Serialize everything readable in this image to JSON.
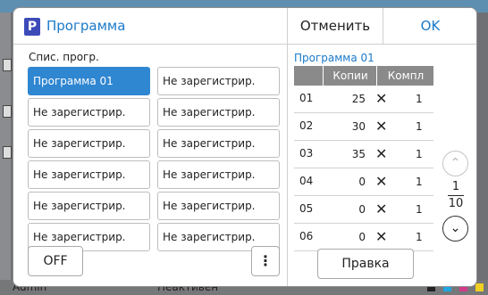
{
  "background": {
    "status": {
      "user": "Admin",
      "state": "Неактивен"
    }
  },
  "dialog": {
    "title": "Программа",
    "icon_letter": "P",
    "cancel_label": "Отменить",
    "ok_label": "OK"
  },
  "program_list": {
    "label": "Спис. прогр.",
    "items": [
      {
        "label": "Программа 01",
        "selected": true
      },
      {
        "label": "Не зарегистрир."
      },
      {
        "label": "Не зарегистрир."
      },
      {
        "label": "Не зарегистрир."
      },
      {
        "label": "Не зарегистрир."
      },
      {
        "label": "Не зарегистрир."
      },
      {
        "label": "Не зарегистрир."
      },
      {
        "label": "Не зарегистрир."
      },
      {
        "label": "Не зарегистрир."
      },
      {
        "label": "Не зарегистрир."
      },
      {
        "label": "Не зарегистрир."
      },
      {
        "label": "Не зарегистрир."
      }
    ],
    "off_label": "OFF",
    "more_label": "⋮"
  },
  "program_detail": {
    "title": "Программа 01",
    "headers": {
      "copies": "Копии",
      "sets": "Компл"
    },
    "times_symbol": "✕",
    "rows": [
      {
        "num": "01",
        "copies": "25",
        "sets": "1"
      },
      {
        "num": "02",
        "copies": "30",
        "sets": "1"
      },
      {
        "num": "03",
        "copies": "35",
        "sets": "1"
      },
      {
        "num": "04",
        "copies": "0",
        "sets": "1"
      },
      {
        "num": "05",
        "copies": "0",
        "sets": "1"
      },
      {
        "num": "06",
        "copies": "0",
        "sets": "1"
      }
    ],
    "page": {
      "current": "1",
      "total": "10"
    },
    "edit_label": "Правка"
  },
  "colors": {
    "accent": "#1979c9",
    "selected": "#2f86d1",
    "header_gray": "#8a8a8a",
    "icon_blue": "#3c4bb8"
  }
}
